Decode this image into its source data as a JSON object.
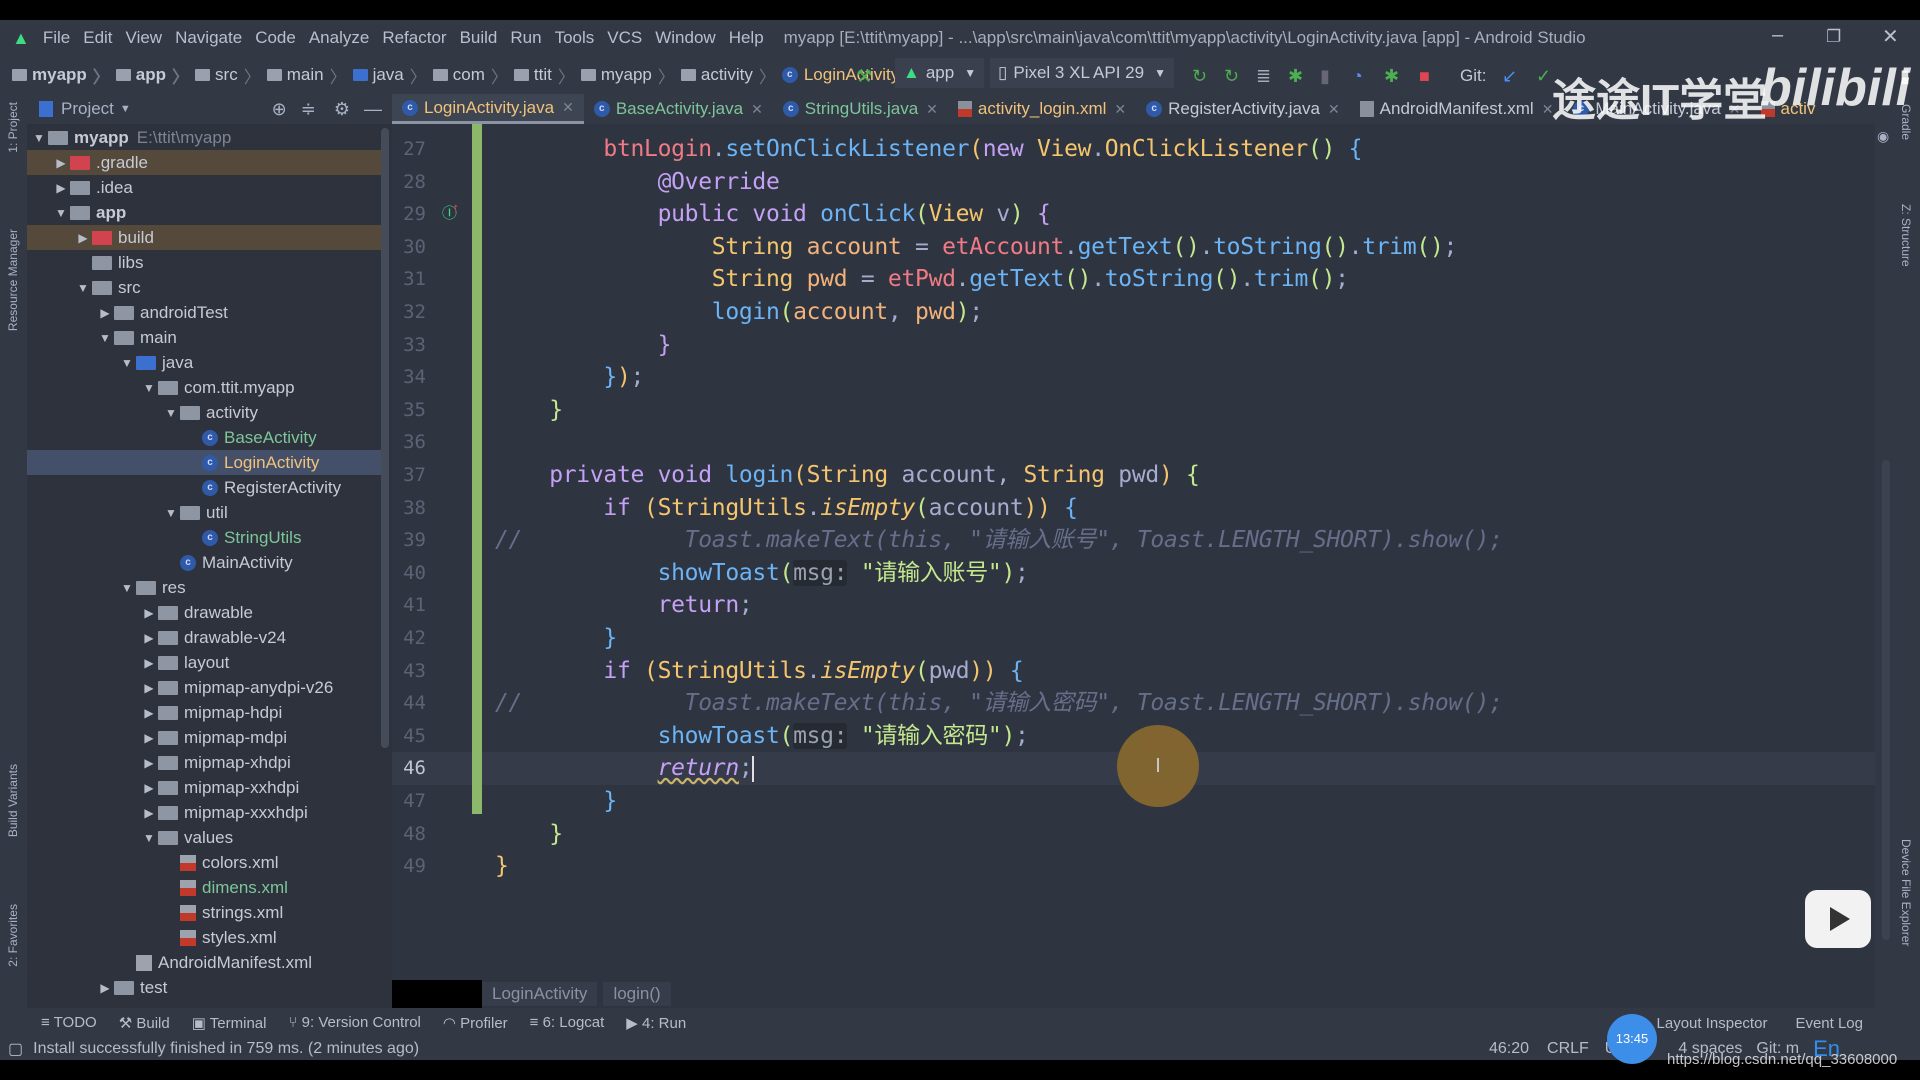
{
  "menubar": {
    "items": [
      "File",
      "Edit",
      "View",
      "Navigate",
      "Code",
      "Analyze",
      "Refactor",
      "Build",
      "Run",
      "Tools",
      "VCS",
      "Window",
      "Help"
    ],
    "title": "myapp [E:\\ttit\\myapp] - ...\\app\\src\\main\\java\\com\\ttit\\myapp\\activity\\LoginActivity.java [app] - Android Studio",
    "minimize": "–",
    "restore": "❐",
    "close": "✕"
  },
  "breadcrumbs": [
    "myapp",
    "app",
    "src",
    "main",
    "java",
    "com",
    "ttit",
    "myapp",
    "activity",
    "LoginActivity"
  ],
  "toolbar": {
    "run_config": "app",
    "device": "Pixel 3 XL API 29",
    "git_label": "Git:"
  },
  "project_panel": {
    "title": "Project",
    "view_mode": "Project"
  },
  "tabs": [
    {
      "label": "LoginActivity.java",
      "type": "class",
      "active": true
    },
    {
      "label": "BaseActivity.java",
      "type": "class"
    },
    {
      "label": "StringUtils.java",
      "type": "class"
    },
    {
      "label": "activity_login.xml",
      "type": "xml"
    },
    {
      "label": "RegisterActivity.java",
      "type": "class"
    },
    {
      "label": "AndroidManifest.xml",
      "type": "manifest"
    },
    {
      "label": "MainActivity.java",
      "type": "class"
    },
    {
      "label": "activ",
      "type": "xml"
    }
  ],
  "tree": [
    {
      "label": "myapp",
      "extra": "E:\\ttit\\myapp",
      "level": 0,
      "arrow": "down",
      "icon": "module",
      "bold": true
    },
    {
      "label": ".gradle",
      "level": 1,
      "arrow": "right",
      "icon": "folder-red",
      "ignored": true
    },
    {
      "label": ".idea",
      "level": 1,
      "arrow": "right",
      "icon": "folder"
    },
    {
      "label": "app",
      "level": 1,
      "arrow": "down",
      "icon": "module",
      "bold": true
    },
    {
      "label": "build",
      "level": 2,
      "arrow": "right",
      "icon": "folder-red",
      "ignored": true
    },
    {
      "label": "libs",
      "level": 2,
      "icon": "folder"
    },
    {
      "label": "src",
      "level": 2,
      "arrow": "down",
      "icon": "folder"
    },
    {
      "label": "androidTest",
      "level": 3,
      "arrow": "right",
      "icon": "folder"
    },
    {
      "label": "main",
      "level": 3,
      "arrow": "down",
      "icon": "folder"
    },
    {
      "label": "java",
      "level": 4,
      "arrow": "down",
      "icon": "folder-blue"
    },
    {
      "label": "com.ttit.myapp",
      "level": 5,
      "arrow": "down",
      "icon": "package"
    },
    {
      "label": "activity",
      "level": 6,
      "arrow": "down",
      "icon": "package"
    },
    {
      "label": "BaseActivity",
      "level": 7,
      "icon": "class",
      "color": "#7ec699"
    },
    {
      "label": "LoginActivity",
      "level": 7,
      "icon": "class",
      "color": "#f0c27a",
      "selected": true
    },
    {
      "label": "RegisterActivity",
      "level": 7,
      "icon": "class"
    },
    {
      "label": "util",
      "level": 6,
      "arrow": "down",
      "icon": "package"
    },
    {
      "label": "StringUtils",
      "level": 7,
      "icon": "class",
      "color": "#7ec699"
    },
    {
      "label": "MainActivity",
      "level": 6,
      "icon": "class"
    },
    {
      "label": "res",
      "level": 4,
      "arrow": "down",
      "icon": "folder"
    },
    {
      "label": "drawable",
      "level": 5,
      "arrow": "right",
      "icon": "folder"
    },
    {
      "label": "drawable-v24",
      "level": 5,
      "arrow": "right",
      "icon": "folder"
    },
    {
      "label": "layout",
      "level": 5,
      "arrow": "right",
      "icon": "folder"
    },
    {
      "label": "mipmap-anydpi-v26",
      "level": 5,
      "arrow": "right",
      "icon": "folder"
    },
    {
      "label": "mipmap-hdpi",
      "level": 5,
      "arrow": "right",
      "icon": "folder"
    },
    {
      "label": "mipmap-mdpi",
      "level": 5,
      "arrow": "right",
      "icon": "folder"
    },
    {
      "label": "mipmap-xhdpi",
      "level": 5,
      "arrow": "right",
      "icon": "folder"
    },
    {
      "label": "mipmap-xxhdpi",
      "level": 5,
      "arrow": "right",
      "icon": "folder"
    },
    {
      "label": "mipmap-xxxhdpi",
      "level": 5,
      "arrow": "right",
      "icon": "folder"
    },
    {
      "label": "values",
      "level": 5,
      "arrow": "down",
      "icon": "folder"
    },
    {
      "label": "colors.xml",
      "level": 6,
      "icon": "xml"
    },
    {
      "label": "dimens.xml",
      "level": 6,
      "icon": "xml",
      "color": "#7ec699"
    },
    {
      "label": "strings.xml",
      "level": 6,
      "icon": "xml"
    },
    {
      "label": "styles.xml",
      "level": 6,
      "icon": "xml"
    },
    {
      "label": "AndroidManifest.xml",
      "level": 4,
      "icon": "manifest"
    },
    {
      "label": "test",
      "level": 3,
      "arrow": "right",
      "icon": "folder"
    }
  ],
  "editor": {
    "first_line": 27,
    "current_line": 46,
    "lines": [
      [
        [
          "        "
        ],
        [
          "btnLogin",
          "f"
        ],
        [
          ".",
          "p"
        ],
        [
          "setOnClickListener",
          "m"
        ],
        [
          "(",
          "t"
        ],
        [
          "new",
          "k"
        ],
        [
          " "
        ],
        [
          "View",
          "t"
        ],
        [
          ".",
          "p"
        ],
        [
          "OnClickListener",
          "t"
        ],
        [
          "()",
          "s"
        ],
        [
          " {",
          "m"
        ]
      ],
      [
        [
          "            "
        ],
        [
          "@Override",
          "a"
        ]
      ],
      [
        [
          "            "
        ],
        [
          "public void",
          "k"
        ],
        [
          " "
        ],
        [
          "onClick",
          "m"
        ],
        [
          "(",
          "s"
        ],
        [
          "View",
          "t"
        ],
        [
          " v",
          "p"
        ],
        [
          ")",
          "s"
        ],
        [
          " {",
          "k"
        ]
      ],
      [
        [
          "                "
        ],
        [
          "String",
          "t"
        ],
        [
          " account",
          "v"
        ],
        [
          " = ",
          "p"
        ],
        [
          "etAccount",
          "f"
        ],
        [
          ".",
          "p"
        ],
        [
          "getText",
          "m"
        ],
        [
          "()",
          "s"
        ],
        [
          ".",
          "p"
        ],
        [
          "toString",
          "m"
        ],
        [
          "()",
          "s"
        ],
        [
          ".",
          "p"
        ],
        [
          "trim",
          "m"
        ],
        [
          "()",
          "s"
        ],
        [
          ";",
          "p"
        ]
      ],
      [
        [
          "                "
        ],
        [
          "String",
          "t"
        ],
        [
          " pwd",
          "v"
        ],
        [
          " = ",
          "p"
        ],
        [
          "etPwd",
          "f"
        ],
        [
          ".",
          "p"
        ],
        [
          "getText",
          "m"
        ],
        [
          "()",
          "s"
        ],
        [
          ".",
          "p"
        ],
        [
          "toString",
          "m"
        ],
        [
          "()",
          "s"
        ],
        [
          ".",
          "p"
        ],
        [
          "trim",
          "m"
        ],
        [
          "()",
          "s"
        ],
        [
          ";",
          "p"
        ]
      ],
      [
        [
          "                "
        ],
        [
          "login",
          "m"
        ],
        [
          "(",
          "s"
        ],
        [
          "account",
          "v"
        ],
        [
          ", ",
          "p"
        ],
        [
          "pwd",
          "v"
        ],
        [
          ")",
          "s"
        ],
        [
          ";",
          "p"
        ]
      ],
      [
        [
          "            "
        ],
        [
          "}",
          "k"
        ]
      ],
      [
        [
          "        "
        ],
        [
          "}",
          "m"
        ],
        [
          ")",
          "t"
        ],
        [
          ";",
          "p"
        ]
      ],
      [
        [
          "    "
        ],
        [
          "}",
          "s"
        ]
      ],
      [],
      [
        [
          "    "
        ],
        [
          "private void",
          "k"
        ],
        [
          " "
        ],
        [
          "login",
          "m"
        ],
        [
          "(",
          "t"
        ],
        [
          "String",
          "t"
        ],
        [
          " account, ",
          "p"
        ],
        [
          "String",
          "t"
        ],
        [
          " pwd",
          "p"
        ],
        [
          ")",
          "t"
        ],
        [
          " {",
          "s"
        ]
      ],
      [
        [
          "        "
        ],
        [
          "if",
          "k"
        ],
        [
          " (",
          "t"
        ],
        [
          "StringUtils",
          "t"
        ],
        [
          ".",
          "p"
        ],
        [
          "isEmpty",
          "st"
        ],
        [
          "(",
          "s"
        ],
        [
          "account",
          "p"
        ],
        [
          "))",
          "t"
        ],
        [
          " {",
          "m"
        ]
      ],
      [
        [
          "//            Toast.makeText(this, \"请输入账号\", Toast.LENGTH_SHORT).show();",
          "c"
        ]
      ],
      [
        [
          "            "
        ],
        [
          "showToast",
          "m"
        ],
        [
          "(",
          "s"
        ],
        [
          "msg:",
          "h"
        ],
        [
          " "
        ],
        [
          "\"请输入账号\"",
          "s"
        ],
        [
          ")",
          "s"
        ],
        [
          ";",
          "p"
        ]
      ],
      [
        [
          "            "
        ],
        [
          "return",
          "k"
        ],
        [
          ";",
          "p"
        ]
      ],
      [
        [
          "        "
        ],
        [
          "}",
          "m"
        ]
      ],
      [
        [
          "        "
        ],
        [
          "if",
          "k"
        ],
        [
          " (",
          "t"
        ],
        [
          "StringUtils",
          "t"
        ],
        [
          ".",
          "p"
        ],
        [
          "isEmpty",
          "st"
        ],
        [
          "(",
          "s"
        ],
        [
          "pwd",
          "p"
        ],
        [
          "))",
          "t"
        ],
        [
          " {",
          "m"
        ]
      ],
      [
        [
          "//            Toast.makeText(this, \"请输入密码\", Toast.LENGTH_SHORT).show();",
          "c"
        ]
      ],
      [
        [
          "            "
        ],
        [
          "showToast",
          "m"
        ],
        [
          "(",
          "s"
        ],
        [
          "msg:",
          "h"
        ],
        [
          " "
        ],
        [
          "\"请输入密码\"",
          "s"
        ],
        [
          ")",
          "s"
        ],
        [
          ";",
          "p"
        ]
      ],
      [
        [
          "            "
        ],
        [
          "return",
          "k wavy"
        ],
        [
          ";",
          "p"
        ],
        [
          "",
          "caret"
        ]
      ],
      [
        [
          "        "
        ],
        [
          "}",
          "m"
        ]
      ],
      [
        [
          "    "
        ],
        [
          "}",
          "s"
        ]
      ],
      [
        [
          "}",
          "t"
        ]
      ]
    ]
  },
  "editor_breadcrumb": [
    "LoginActivity",
    "login()"
  ],
  "tool_windows": [
    "TODO",
    "Build",
    "Terminal",
    "9: Version Control",
    "Profiler",
    "6: Logcat",
    "4: Run"
  ],
  "tool_windows_right": [
    "Layout Inspector",
    "Event Log"
  ],
  "left_strip": [
    "1: Project",
    "Resource Manager",
    "Build Variants",
    "2: Favorites"
  ],
  "right_strip": [
    "Gradle",
    "Z: Structure",
    "Device File Explorer"
  ],
  "status": {
    "message": "Install successfully finished in 759 ms. (2 minutes ago)",
    "position": "46:20",
    "line_sep": "CRLF",
    "encoding": "U",
    "indent": "4 spaces",
    "git": "Git: m",
    "ime": "En"
  },
  "overlay": {
    "clock": "13:45",
    "watermark_cn": "途途IT学堂",
    "watermark_logo": "bilibili",
    "watermark_url": "https://blog.csdn.net/qq_33608000",
    "mouse_cursor": "I"
  }
}
